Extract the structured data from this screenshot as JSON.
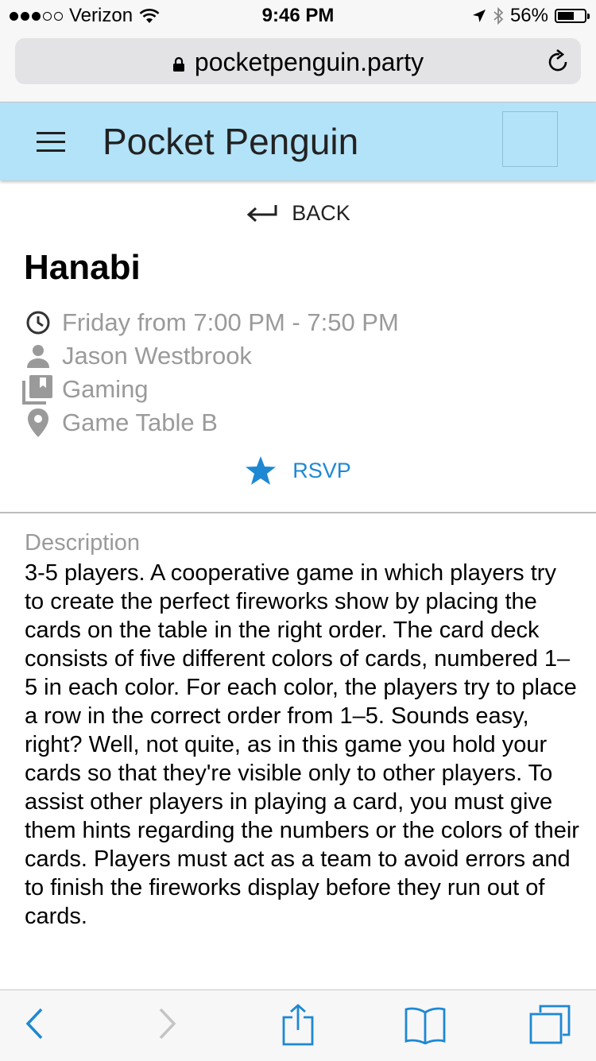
{
  "status_bar": {
    "carrier": "Verizon",
    "time": "9:46 PM",
    "battery": "56%"
  },
  "browser": {
    "url": "pocketpenguin.party"
  },
  "navbar": {
    "title": "Pocket Penguin"
  },
  "event": {
    "back_label": "BACK",
    "title": "Hanabi",
    "time": "Friday from 7:00 PM - 7:50 PM",
    "host": "Jason Westbrook",
    "category": "Gaming",
    "location": "Game Table B",
    "rsvp_label": "RSVP",
    "description_label": "Description",
    "description": "3-5 players. A cooperative game in which players try to create the perfect fireworks show by placing the cards on the table in the right order. The card deck consists of five different colors of cards, numbered 1–5 in each color. For each color, the players try to place a row in the correct order from 1–5. Sounds easy, right? Well, not quite, as in this game you hold your cards so that they're visible only to other players. To assist other players in playing a card, you must give them hints regarding the numbers or the colors of their cards. Players must act as a team to avoid errors and to finish the fireworks display before they run out of cards."
  },
  "icons": {
    "time": "clock-icon",
    "host": "person-icon",
    "category": "library-icon",
    "location": "location-pin-icon",
    "rsvp": "star-icon"
  },
  "colors": {
    "navbar_bg": "#b3e3f8",
    "accent": "#1e88d3",
    "meta_text": "#9a9a9a"
  }
}
